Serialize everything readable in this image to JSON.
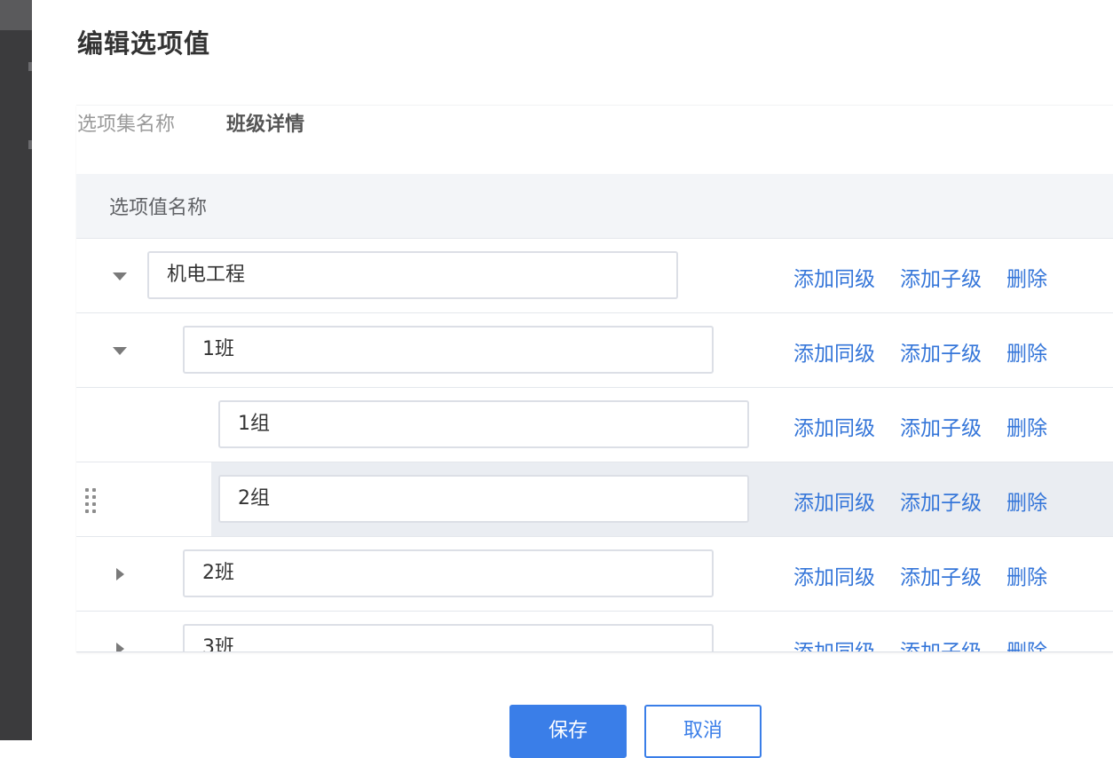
{
  "dialog": {
    "title": "编辑选项值",
    "set_name_label": "选项集名称",
    "set_name_value": "班级详情"
  },
  "table": {
    "header": "选项值名称",
    "actions": {
      "add_sibling": "添加同级",
      "add_child": "添加子级",
      "delete": "删除"
    },
    "rows": [
      {
        "value": "机电工程",
        "level": 0,
        "toggle": "expanded"
      },
      {
        "value": "1班",
        "level": 1,
        "toggle": "expanded"
      },
      {
        "value": "1组",
        "level": 2,
        "toggle": "none"
      },
      {
        "value": "2组",
        "level": 2,
        "toggle": "none",
        "hovered": true,
        "draggable": true
      },
      {
        "value": "2班",
        "level": 1,
        "toggle": "collapsed"
      },
      {
        "value": "3班",
        "level": 1,
        "toggle": "collapsed"
      }
    ]
  },
  "footer": {
    "save_label": "保存",
    "cancel_label": "取消"
  },
  "colors": {
    "link": "#3576d9",
    "primary": "#3a7ee8",
    "header_bg": "#f3f5f8",
    "hover_bg": "#eaedf2"
  },
  "icons": [
    "caret-down-icon",
    "caret-right-icon",
    "drag-handle-icon"
  ]
}
